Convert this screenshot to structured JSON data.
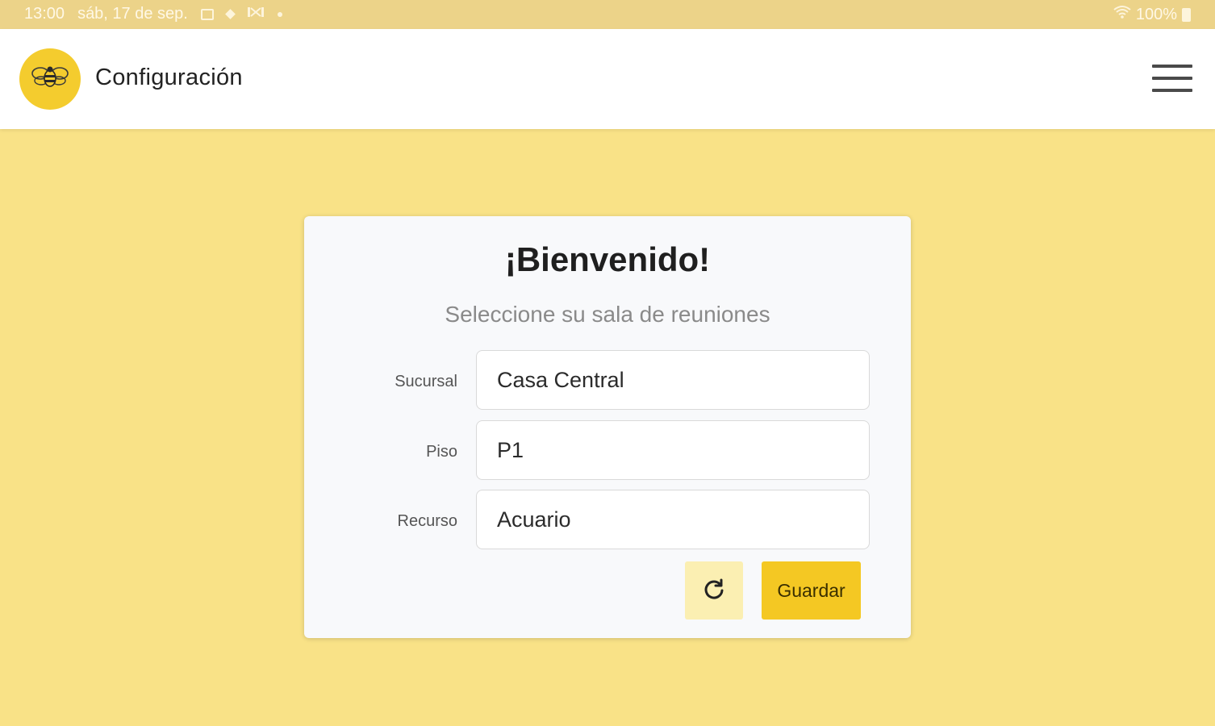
{
  "status_bar": {
    "time": "13:00",
    "date": "sáb, 17 de sep.",
    "icons": [
      "image-icon",
      "diamond-icon",
      "signal-icon",
      "dot-icon"
    ],
    "right_icons": [
      "wifi-icon",
      "battery-icon"
    ],
    "battery": "100%"
  },
  "appbar": {
    "logo_icon": "bee-icon",
    "title": "Configuración",
    "menu_icon": "hamburger-menu-icon"
  },
  "card": {
    "title": "¡Bienvenido!",
    "subtitle": "Seleccione su sala de reuniones",
    "fields": [
      {
        "label": "Sucursal",
        "value": "Casa Central"
      },
      {
        "label": "Piso",
        "value": "P1"
      },
      {
        "label": "Recurso",
        "value": "Acuario"
      }
    ],
    "refresh_icon": "refresh-icon",
    "save_label": "Guardar"
  },
  "colors": {
    "background": "#f9e287",
    "status_bar": "#ecd389",
    "accent": "#f4c823",
    "logo": "#f4cc2e",
    "refresh_button": "#fbefb2"
  }
}
